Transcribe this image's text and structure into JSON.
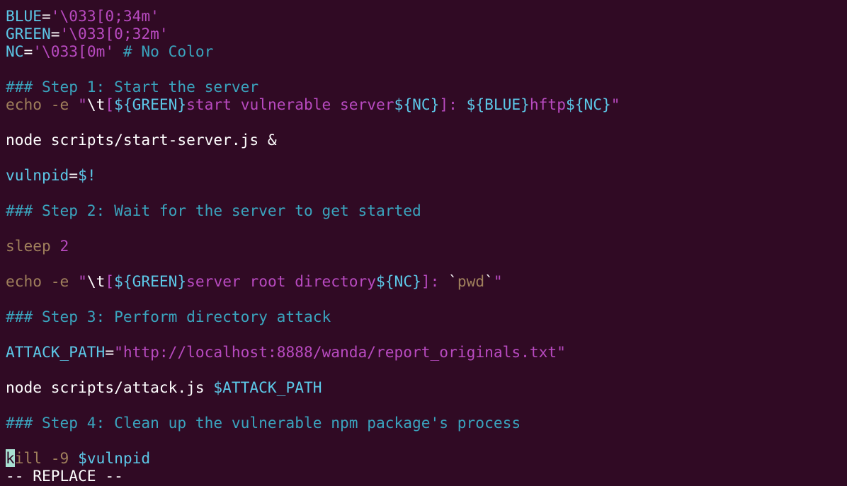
{
  "colors": {
    "background": "#300a24",
    "plain": "#ffffff",
    "variable": "#5cc8e8",
    "string": "#b84ac0",
    "comment": "#3aa4be",
    "builtin": "#a0805c",
    "cursor": "#a8e0d2"
  },
  "lines": [
    [
      {
        "t": "BLUE",
        "c": "variable"
      },
      {
        "t": "=",
        "c": "plain"
      },
      {
        "t": "'\\033[0;34m'",
        "c": "string"
      }
    ],
    [
      {
        "t": "GREEN",
        "c": "variable"
      },
      {
        "t": "=",
        "c": "plain"
      },
      {
        "t": "'\\033[0;32m'",
        "c": "string"
      }
    ],
    [
      {
        "t": "NC",
        "c": "variable"
      },
      {
        "t": "=",
        "c": "plain"
      },
      {
        "t": "'\\033[0m'",
        "c": "string"
      },
      {
        "t": " # No Color",
        "c": "comment"
      }
    ],
    [],
    [
      {
        "t": "### Step 1: Start the server",
        "c": "comment"
      }
    ],
    [
      {
        "t": "echo",
        "c": "builtin"
      },
      {
        "t": " -e ",
        "c": "builtin"
      },
      {
        "t": "\"",
        "c": "string"
      },
      {
        "t": "\\t",
        "c": "plain"
      },
      {
        "t": "[",
        "c": "string"
      },
      {
        "t": "${GREEN}",
        "c": "variable"
      },
      {
        "t": "start vulnerable server",
        "c": "string"
      },
      {
        "t": "${NC}",
        "c": "variable"
      },
      {
        "t": "]: ",
        "c": "string"
      },
      {
        "t": "${BLUE}",
        "c": "variable"
      },
      {
        "t": "hftp",
        "c": "string"
      },
      {
        "t": "${NC}",
        "c": "variable"
      },
      {
        "t": "\"",
        "c": "string"
      }
    ],
    [],
    [
      {
        "t": "node scripts/start-server.js &",
        "c": "plain"
      }
    ],
    [],
    [
      {
        "t": "vulnpid",
        "c": "variable"
      },
      {
        "t": "=",
        "c": "plain"
      },
      {
        "t": "$!",
        "c": "variable"
      }
    ],
    [],
    [
      {
        "t": "### Step 2: Wait for the server to get started",
        "c": "comment"
      }
    ],
    [],
    [
      {
        "t": "sleep",
        "c": "builtin"
      },
      {
        "t": " 2",
        "c": "string"
      }
    ],
    [],
    [
      {
        "t": "echo",
        "c": "builtin"
      },
      {
        "t": " -e ",
        "c": "builtin"
      },
      {
        "t": "\"",
        "c": "string"
      },
      {
        "t": "\\t",
        "c": "plain"
      },
      {
        "t": "[",
        "c": "string"
      },
      {
        "t": "${GREEN}",
        "c": "variable"
      },
      {
        "t": "server root directory",
        "c": "string"
      },
      {
        "t": "${NC}",
        "c": "variable"
      },
      {
        "t": "]: ",
        "c": "string"
      },
      {
        "t": "`",
        "c": "plain"
      },
      {
        "t": "pwd",
        "c": "builtin"
      },
      {
        "t": "`",
        "c": "plain"
      },
      {
        "t": "\"",
        "c": "string"
      }
    ],
    [],
    [
      {
        "t": "### Step 3: Perform directory attack",
        "c": "comment"
      }
    ],
    [],
    [
      {
        "t": "ATTACK_PATH",
        "c": "variable"
      },
      {
        "t": "=",
        "c": "plain"
      },
      {
        "t": "\"http://localhost:8888/wanda/report_originals.txt\"",
        "c": "string"
      }
    ],
    [],
    [
      {
        "t": "node scripts/attack.js ",
        "c": "plain"
      },
      {
        "t": "$ATTACK_PATH",
        "c": "variable"
      }
    ],
    [],
    [
      {
        "t": "### Step 4: Clean up the vulnerable npm package's process",
        "c": "comment"
      }
    ],
    [],
    [
      {
        "t": "k",
        "c": "builtin",
        "cursor": true
      },
      {
        "t": "ill -9 ",
        "c": "builtin"
      },
      {
        "t": "$vulnpid",
        "c": "variable"
      }
    ]
  ],
  "status": {
    "mode": "-- REPLACE --"
  }
}
